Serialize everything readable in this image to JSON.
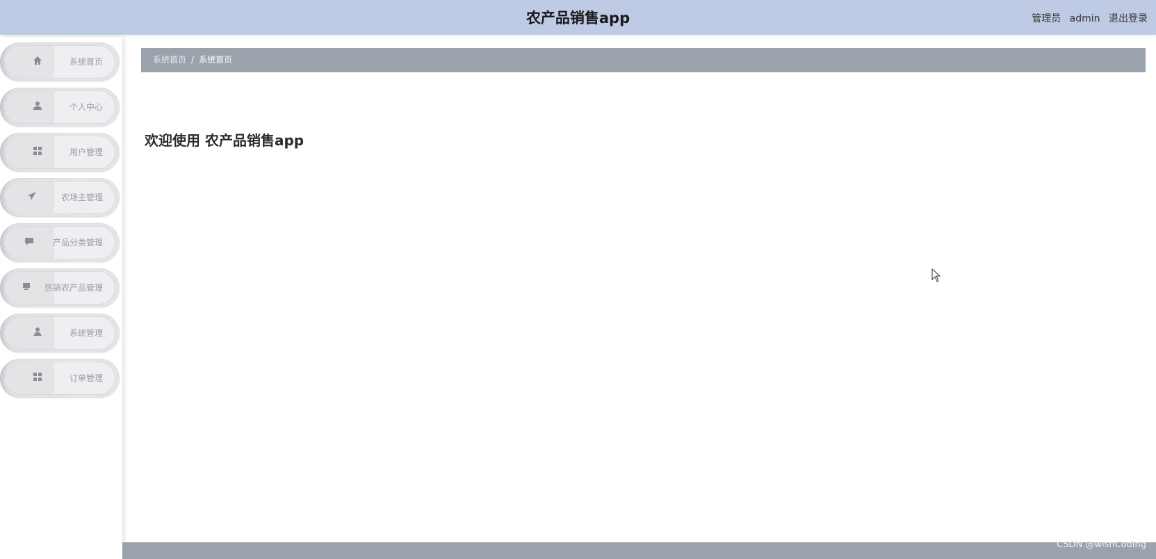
{
  "header": {
    "title": "农产品销售app",
    "role": "管理员",
    "username": "admin",
    "logout_label": "退出登录"
  },
  "sidebar": {
    "items": [
      {
        "label": "系统首页",
        "icon": "home-icon"
      },
      {
        "label": "个人中心",
        "icon": "user-icon"
      },
      {
        "label": "用户管理",
        "icon": "grid-icon"
      },
      {
        "label": "农场主管理",
        "icon": "send-icon"
      },
      {
        "label": "产品分类管理",
        "icon": "chat-icon"
      },
      {
        "label": "热销农产品管理",
        "icon": "store-icon"
      },
      {
        "label": "系统管理",
        "icon": "person-icon"
      },
      {
        "label": "订单管理",
        "icon": "grid-icon"
      }
    ]
  },
  "breadcrumb": {
    "root": "系统首页",
    "separator": "/",
    "current": "系统首页"
  },
  "main": {
    "welcome": "欢迎使用 农产品销售app"
  },
  "watermark": "CSDN @wishCoding",
  "colors": {
    "header_bg": "#bfcbe4",
    "breadcrumb_bg": "#9aa2ab",
    "footer_bg": "#9aa2ab"
  }
}
